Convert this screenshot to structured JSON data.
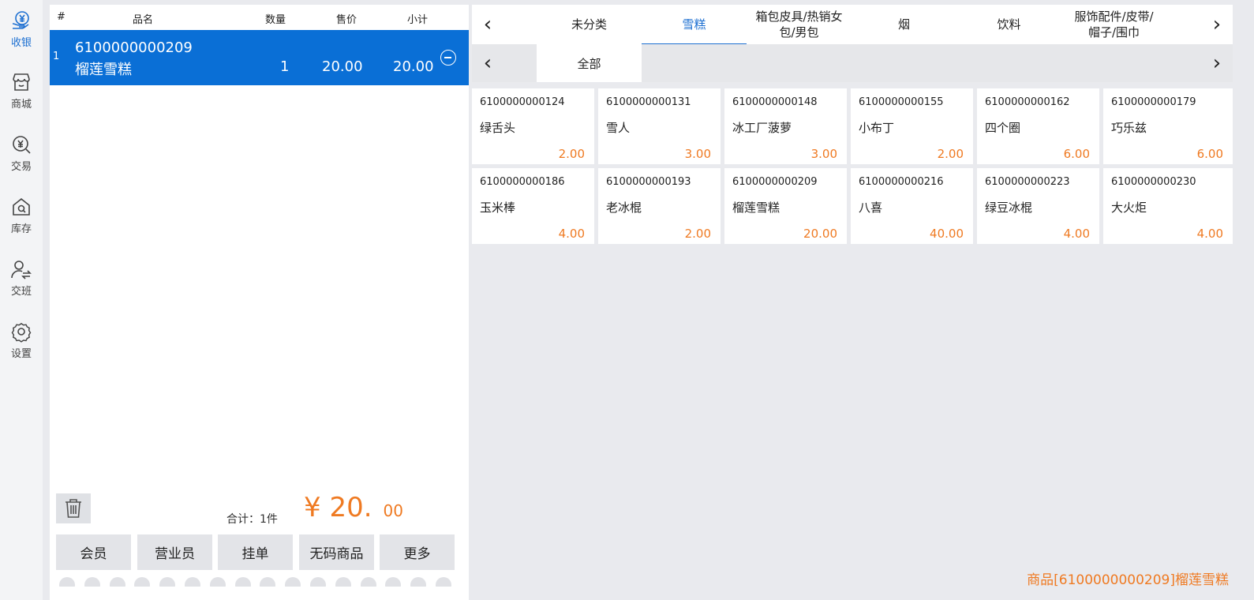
{
  "sidebar": {
    "items": [
      {
        "label": "收银",
        "icon": "cashier-icon",
        "active": true
      },
      {
        "label": "商城",
        "icon": "shop-icon"
      },
      {
        "label": "交易",
        "icon": "transaction-icon"
      },
      {
        "label": "库存",
        "icon": "inventory-icon"
      },
      {
        "label": "交班",
        "icon": "shift-handover-icon"
      },
      {
        "label": "设置",
        "icon": "settings-gear-icon"
      }
    ]
  },
  "cart": {
    "headers": {
      "index": "#",
      "name": "品名",
      "qty": "数量",
      "price": "售价",
      "subtotal": "小计"
    },
    "rows": [
      {
        "index": "1",
        "code": "6100000000209",
        "name": "榴莲雪糕",
        "qty": "1",
        "price": "20.00",
        "subtotal": "20.00"
      }
    ],
    "total_label": "合计：1件",
    "total_currency": "¥",
    "total_int": "20.",
    "total_cents": "00",
    "buttons": [
      "会员",
      "营业员",
      "挂单",
      "无码商品",
      "更多"
    ]
  },
  "categories": {
    "tabs": [
      "未分类",
      "雪糕",
      "箱包皮具/热销女包/男包",
      "烟",
      "饮料",
      "服饰配件/皮带/帽子/围巾"
    ],
    "active_tab": "雪糕",
    "sub_tabs": [
      "全部"
    ],
    "prev_arrow": "‹",
    "next_arrow": "›"
  },
  "products": [
    {
      "code": "6100000000124",
      "name": "绿舌头",
      "price": "2.00"
    },
    {
      "code": "6100000000131",
      "name": "雪人",
      "price": "3.00"
    },
    {
      "code": "6100000000148",
      "name": "冰工厂菠萝",
      "price": "3.00"
    },
    {
      "code": "6100000000155",
      "name": "小布丁",
      "price": "2.00"
    },
    {
      "code": "6100000000162",
      "name": "四个圈",
      "price": "6.00"
    },
    {
      "code": "6100000000179",
      "name": "巧乐兹",
      "price": "6.00"
    },
    {
      "code": "6100000000186",
      "name": "玉米棒",
      "price": "4.00"
    },
    {
      "code": "6100000000193",
      "name": "老冰棍",
      "price": "2.00"
    },
    {
      "code": "6100000000209",
      "name": "榴莲雪糕",
      "price": "20.00"
    },
    {
      "code": "6100000000216",
      "name": "八喜",
      "price": "40.00"
    },
    {
      "code": "6100000000223",
      "name": "绿豆冰棍",
      "price": "4.00"
    },
    {
      "code": "6100000000230",
      "name": "大火炬",
      "price": "4.00"
    }
  ],
  "status_text": "商品[6100000000209]榴莲雪糕",
  "colors": {
    "accent": "#1c6fd1",
    "selected_row": "#0a6fd6",
    "price": "#ef7a22"
  }
}
